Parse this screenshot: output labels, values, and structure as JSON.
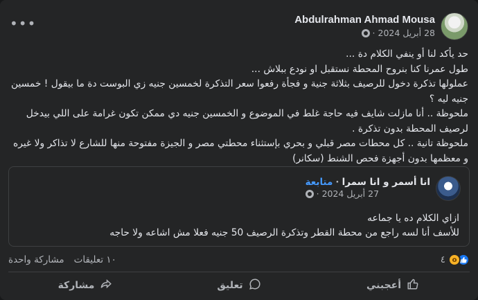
{
  "post": {
    "author": "Abdulrahman Ahmad Mousa",
    "date": "28 أبريل 2024",
    "separator": "·",
    "more_label": "•••",
    "text_lines": [
      "حد يأكد لنا أو ينفي الكلام دة ...",
      "طول عمرنا كنا بنروح المحطة نستقبل او نودع ببلاش ...",
      "عملولها تذكرة دخول للرصيف بثلاثة جنية و فجأة رفعوا سعر التذكرة لخمسين جنيه زي البوست دة ما بيقول ! خمسين جنيه ليه ؟",
      "ملحوظة .. أنا مازلت شايف فيه حاجة غلط في الموضوع و الخمسين جنيه دي ممكن تكون غرامة على اللي بيدخل لرصيف المحطة بدون تذكرة .",
      "ملحوظة تانية .. كل محطات مصر قبلي و بحري بإستثناء محطتي مصر و الجيزة مفتوحة منها للشارع لا تذاكر ولا غيره و معظمها بدون أجهزة فحص الشنط (سكانر)"
    ]
  },
  "shared": {
    "author": "انا أسمر و انا سمرا",
    "separator": "·",
    "follow_label": "متابعة",
    "date": "27 أبريل 2024",
    "text_lines": [
      "ازاي الكلام ده يا جماعه",
      "للأسف أنا لسه راجع من محطة القطر وتذكرة الرصيف 50 جنيه فعلا مش اشاعه ولا حاجه"
    ]
  },
  "stats": {
    "reaction_count": "٤",
    "comments": "١٠ تعليقات",
    "shares": "مشاركة واحدة"
  },
  "actions": {
    "like": "أعجبني",
    "comment": "تعليق",
    "share": "مشاركة"
  },
  "colors": {
    "background": "#242526",
    "text": "#e4e6eb",
    "secondary": "#b0b3b8",
    "accent": "#4599ff",
    "like": "#1877f2"
  }
}
